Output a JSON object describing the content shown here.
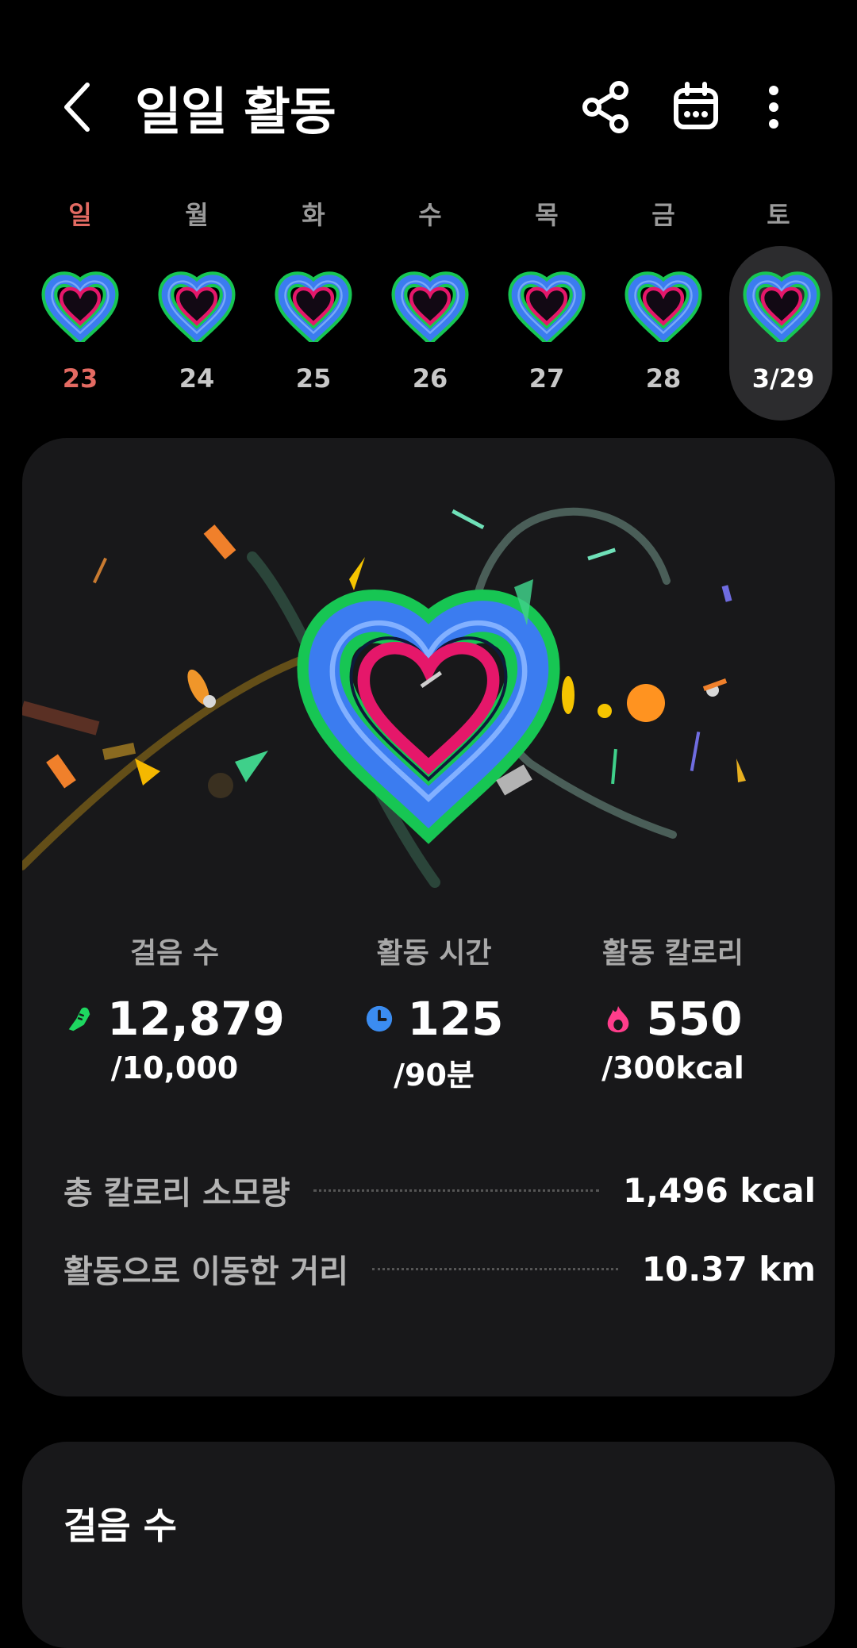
{
  "header": {
    "title": "일일 활동",
    "back_icon": "chevron-left-icon",
    "share_icon": "share-icon",
    "calendar_icon": "calendar-icon",
    "more_icon": "more-vertical-icon"
  },
  "week": {
    "days": [
      {
        "dow": "일",
        "date": "23"
      },
      {
        "dow": "월",
        "date": "24"
      },
      {
        "dow": "화",
        "date": "25"
      },
      {
        "dow": "수",
        "date": "26"
      },
      {
        "dow": "목",
        "date": "27"
      },
      {
        "dow": "금",
        "date": "28"
      },
      {
        "dow": "토",
        "date": "3/29"
      }
    ],
    "selected_index": 6
  },
  "stats": {
    "steps": {
      "label": "걸음 수",
      "value": "12,879",
      "goal": "/10,000",
      "icon": "shoe-icon",
      "color": "#1ed760"
    },
    "active_time": {
      "label": "활동 시간",
      "value": "125",
      "goal": "/90분",
      "icon": "clock-icon",
      "color": "#3b8cf0"
    },
    "active_calories": {
      "label": "활동 칼로리",
      "value": "550",
      "goal": "/300kcal",
      "icon": "flame-icon",
      "color": "#ff3d8b"
    }
  },
  "summary": {
    "total_calories": {
      "label": "총 칼로리 소모량",
      "value": "1,496 kcal"
    },
    "distance": {
      "label": "활동으로 이동한 거리",
      "value": "10.37 km"
    }
  },
  "next_section": {
    "title": "걸음 수"
  },
  "colors": {
    "background": "#000000",
    "card": "#18181a",
    "ring_outer": "#17c653",
    "ring_middle": "#3b7cf0",
    "ring_inner": "#e5176a",
    "sunday": "#e36a62"
  }
}
